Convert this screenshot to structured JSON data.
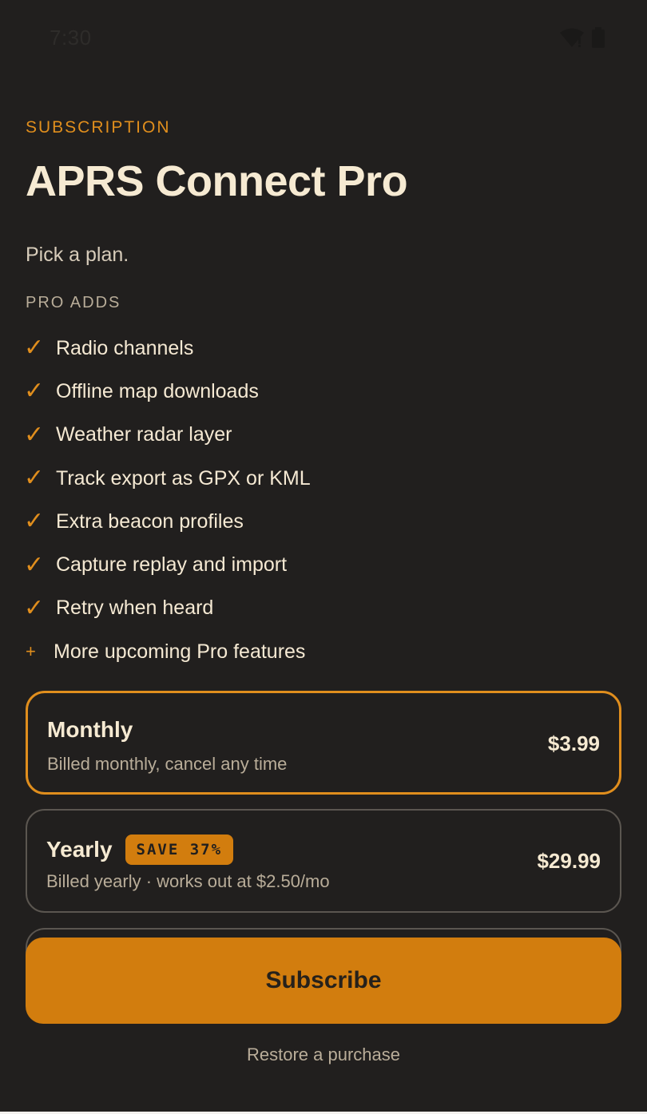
{
  "status_bar": {
    "time": "7:30",
    "icons": [
      "wifi-icon",
      "battery-icon"
    ]
  },
  "header": {
    "eyebrow": "SUBSCRIPTION",
    "title": "APRS Connect Pro",
    "subtitle": "Pick a plan."
  },
  "features": {
    "label": "PRO ADDS",
    "check_glyph": "✓",
    "plus_glyph": "+",
    "items": [
      "Radio channels",
      "Offline map downloads",
      "Weather radar layer",
      "Track export as GPX or KML",
      "Extra beacon profiles",
      "Capture replay and import",
      "Retry when heard"
    ],
    "more": "More upcoming Pro features"
  },
  "plans": [
    {
      "name": "Monthly",
      "description": "Billed monthly, cancel any time",
      "price": "$3.99",
      "selected": true
    },
    {
      "name": "Yearly",
      "badge": "SAVE 37%",
      "description": "Billed yearly · works out at $2.50/mo",
      "price": "$29.99",
      "selected": false
    }
  ],
  "actions": {
    "subscribe_label": "Subscribe",
    "restore_label": "Restore a purchase"
  },
  "colors": {
    "background": "#211f1e",
    "accent": "#e08e1d",
    "button": "#d27d0e",
    "text": "#f5e9d3",
    "muted": "#b9ad99"
  }
}
